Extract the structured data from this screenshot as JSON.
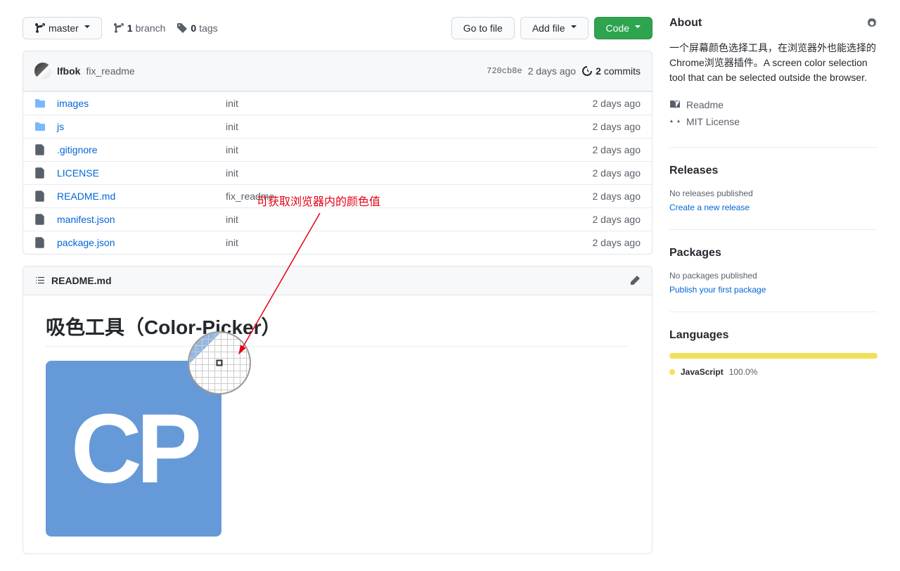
{
  "branch": {
    "current": "master",
    "count": "1",
    "label": "branch"
  },
  "tags": {
    "count": "0",
    "label": "tags"
  },
  "actions": {
    "goToFile": "Go to file",
    "addFile": "Add file",
    "code": "Code"
  },
  "latestCommit": {
    "author": "lfbok",
    "message": "fix_readme",
    "sha": "720cb8e",
    "time": "2 days ago",
    "commitsCount": "2",
    "commitsLabel": "commits"
  },
  "files": [
    {
      "type": "dir",
      "name": "images",
      "msg": "init",
      "time": "2 days ago"
    },
    {
      "type": "dir",
      "name": "js",
      "msg": "init",
      "time": "2 days ago"
    },
    {
      "type": "file",
      "name": ".gitignore",
      "msg": "init",
      "time": "2 days ago"
    },
    {
      "type": "file",
      "name": "LICENSE",
      "msg": "init",
      "time": "2 days ago"
    },
    {
      "type": "file",
      "name": "README.md",
      "msg": "fix_readme",
      "time": "2 days ago"
    },
    {
      "type": "file",
      "name": "manifest.json",
      "msg": "init",
      "time": "2 days ago"
    },
    {
      "type": "file",
      "name": "package.json",
      "msg": "init",
      "time": "2 days ago"
    }
  ],
  "readme": {
    "filename": "README.md",
    "heading": "吸色工具（Color-Picker）",
    "logoText": "CP",
    "annotation": "可获取浏览器内的颜色值"
  },
  "about": {
    "title": "About",
    "description": "一个屏幕颜色选择工具，在浏览器外也能选择的Chrome浏览器插件。A screen color selection tool that can be selected outside the browser.",
    "readmeLink": "Readme",
    "licenseLink": "MIT License"
  },
  "releases": {
    "title": "Releases",
    "empty": "No releases published",
    "createLink": "Create a new release"
  },
  "packages": {
    "title": "Packages",
    "empty": "No packages published",
    "publishLink": "Publish your first package"
  },
  "languages": {
    "title": "Languages",
    "items": [
      {
        "name": "JavaScript",
        "pct": "100.0%",
        "color": "#f1e05a"
      }
    ]
  }
}
